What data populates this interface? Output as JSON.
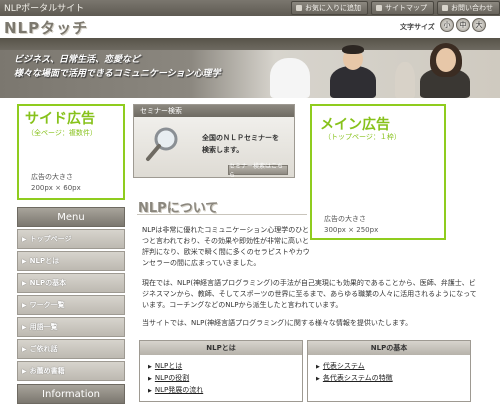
{
  "header": {
    "tagline": "NLPポータルサイト",
    "logo": "NLPタッチ",
    "top_links": [
      {
        "label": "お気に入りに追加"
      },
      {
        "label": "サイトマップ"
      },
      {
        "label": "お問い合わせ"
      }
    ],
    "font_size_label": "文字サイズ",
    "font_size_buttons": [
      "小",
      "中",
      "大"
    ]
  },
  "hero": {
    "line1": "ビジネス、日常生活、恋愛など",
    "line2": "様々な場面で活用できるコミュニケーション心理学"
  },
  "side_ad": {
    "title": "サイド広告",
    "subtitle": "（全ページ：複数件）",
    "size_label": "広告の大きさ",
    "size": "200px × 60px"
  },
  "menu": {
    "heading": "Menu",
    "items": [
      {
        "label": "トップページ"
      },
      {
        "label": "NLPとは"
      },
      {
        "label": "NLPの基本"
      },
      {
        "label": "ワーク一覧"
      },
      {
        "label": "用語一覧"
      },
      {
        "label": "ご依れ話"
      },
      {
        "label": "お薦め書籍"
      }
    ]
  },
  "information": {
    "heading": "Information"
  },
  "seminar": {
    "heading": "セミナー検索",
    "line1": "全国のＮＬＰセミナーを",
    "line2": "検索します。",
    "button": "セミナー検索はこちら"
  },
  "main_ad": {
    "title": "メイン広告",
    "subtitle": "（トップページ：１枠）",
    "size_label": "広告の大きさ",
    "size": "300px × 250px"
  },
  "about": {
    "title": "NLPについて",
    "para1": "NLPは非常に優れたコミュニケーション心理学のひとつと言われており、その効果や即効性が非常に高いと評判になり、欧米で瞬く間に多くのセラピストやカウンセラーの間に広まっていきました。",
    "para2": "現在では、NLP(神経言語プログラミング)の手法が自己実現にも効果的であることから、医師、弁護士、ビジネスマンから、教師、そしてスポーツの世界に至るまで、あらゆる職業の人々に活用されるようになっています。コーチングなどのNLPから派生したと言われています。",
    "para3": "当サイトでは、NLP(神経言語プログラミング)に関する様々な情報を提供いたします。"
  },
  "panels": [
    {
      "heading": "NLPとは",
      "links": [
        "NLPとは",
        "NLPの役割",
        "NLP発展の流れ"
      ]
    },
    {
      "heading": "NLPの基本",
      "links": [
        "代表システム",
        "各代表システムの特徴"
      ]
    }
  ],
  "colors": {
    "accent_green": "#8fcc1e",
    "header_gray": "#6e6a62"
  }
}
